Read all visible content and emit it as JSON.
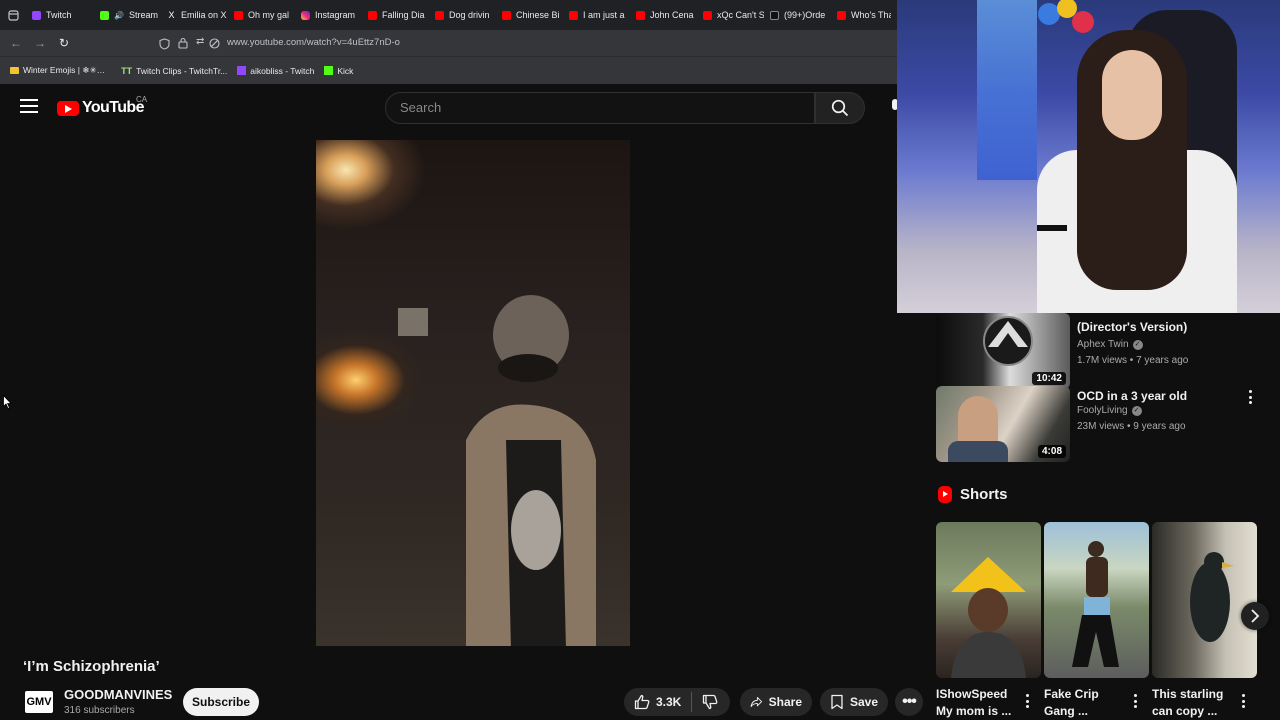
{
  "browser": {
    "tabs": [
      {
        "label": "Twitch",
        "icon": "twitch"
      },
      {
        "label": "Stream",
        "icon": "kick"
      },
      {
        "label": "Emilia on X",
        "icon": "x"
      },
      {
        "label": "Oh my gal",
        "icon": "youtube"
      },
      {
        "label": "Instagram",
        "icon": "instagram"
      },
      {
        "label": "Falling Dia",
        "icon": "youtube"
      },
      {
        "label": "Dog drivin",
        "icon": "youtube"
      },
      {
        "label": "Chinese Bi",
        "icon": "youtube"
      },
      {
        "label": "I am just a",
        "icon": "youtube"
      },
      {
        "label": "John Cena",
        "icon": "youtube"
      },
      {
        "label": "xQc Can't S",
        "icon": "youtube"
      },
      {
        "label": "(99+)Orde",
        "icon": "tiktok"
      },
      {
        "label": "Who's Tha",
        "icon": "youtube"
      }
    ],
    "url": "www.youtube.com/watch?v=4uEttz7nD-o",
    "bookmarks": [
      {
        "label": "Winter Emojis | ❄✳…",
        "icon": "folder"
      },
      {
        "label": "Twitch Clips - TwitchTr...",
        "icon": "tt"
      },
      {
        "label": "aikobliss - Twitch",
        "icon": "twitch"
      },
      {
        "label": "Kick",
        "icon": "kick"
      }
    ]
  },
  "youtube": {
    "logo_text": "YouTube",
    "country": "CA",
    "search_placeholder": "Search"
  },
  "video": {
    "title": "‘I’m Schizophrenia’",
    "channel": {
      "name": "GOODMANVINES",
      "avatar_text": "GMV",
      "subscribers": "316 subscribers"
    },
    "subscribe_label": "Subscribe",
    "likes": "3.3K",
    "share_label": "Share",
    "save_label": "Save"
  },
  "sidebar": {
    "recommendations": [
      {
        "title": "Aphex Twin - Windowlicker (Director's Version)",
        "title_visible": "(Director's Version)",
        "channel": "Aphex Twin",
        "meta": "1.7M views • 7 years ago",
        "duration": "10:42",
        "verified": true
      },
      {
        "title": "OCD in a 3 year old",
        "channel": "FoolyLiving",
        "meta": "23M views • 9 years ago",
        "duration": "4:08",
        "verified": true
      }
    ],
    "shorts_heading": "Shorts",
    "shorts": [
      {
        "title": "IShowSpeed My mom is ..."
      },
      {
        "title": "Fake Crip Gang ..."
      },
      {
        "title": "This starling can copy ..."
      }
    ]
  },
  "colors": {
    "background": "#0f0f0f",
    "youtube_red": "#ff0000",
    "button_gray": "#272727"
  }
}
